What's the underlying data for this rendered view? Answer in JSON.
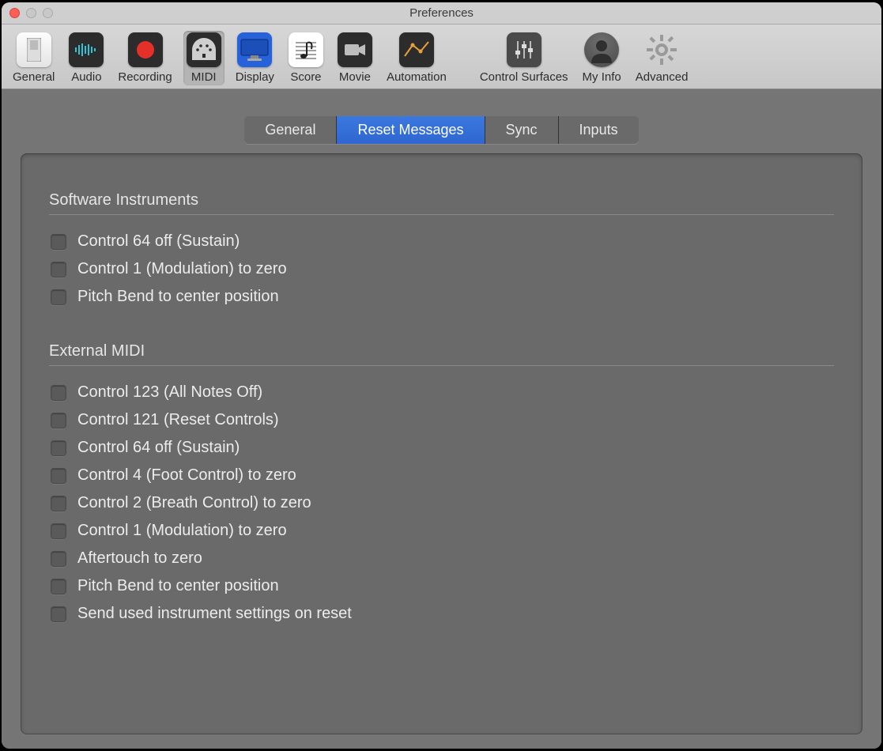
{
  "window": {
    "title": "Preferences"
  },
  "toolbar": {
    "selected": "midi",
    "items": [
      {
        "id": "general",
        "label": "General"
      },
      {
        "id": "audio",
        "label": "Audio"
      },
      {
        "id": "recording",
        "label": "Recording"
      },
      {
        "id": "midi",
        "label": "MIDI"
      },
      {
        "id": "display",
        "label": "Display"
      },
      {
        "id": "score",
        "label": "Score"
      },
      {
        "id": "movie",
        "label": "Movie"
      },
      {
        "id": "automation",
        "label": "Automation"
      },
      {
        "id": "control-surfaces",
        "label": "Control Surfaces"
      },
      {
        "id": "my-info",
        "label": "My Info"
      },
      {
        "id": "advanced",
        "label": "Advanced"
      }
    ]
  },
  "tabs": {
    "active": "reset-messages",
    "items": [
      {
        "id": "general",
        "label": "General"
      },
      {
        "id": "reset-messages",
        "label": "Reset Messages"
      },
      {
        "id": "sync",
        "label": "Sync"
      },
      {
        "id": "inputs",
        "label": "Inputs"
      }
    ]
  },
  "groups": [
    {
      "title": "Software Instruments",
      "options": [
        {
          "label": "Control 64 off (Sustain)",
          "checked": false
        },
        {
          "label": "Control 1 (Modulation) to zero",
          "checked": false
        },
        {
          "label": "Pitch Bend to center position",
          "checked": false
        }
      ]
    },
    {
      "title": "External MIDI",
      "options": [
        {
          "label": "Control 123 (All Notes Off)",
          "checked": false
        },
        {
          "label": "Control 121 (Reset Controls)",
          "checked": false
        },
        {
          "label": "Control 64 off (Sustain)",
          "checked": false
        },
        {
          "label": "Control 4 (Foot Control) to zero",
          "checked": false
        },
        {
          "label": "Control 2 (Breath Control) to zero",
          "checked": false
        },
        {
          "label": "Control 1 (Modulation) to zero",
          "checked": false
        },
        {
          "label": "Aftertouch to zero",
          "checked": false
        },
        {
          "label": "Pitch Bend to center position",
          "checked": false
        },
        {
          "label": "Send used instrument settings on reset",
          "checked": false
        }
      ]
    }
  ]
}
